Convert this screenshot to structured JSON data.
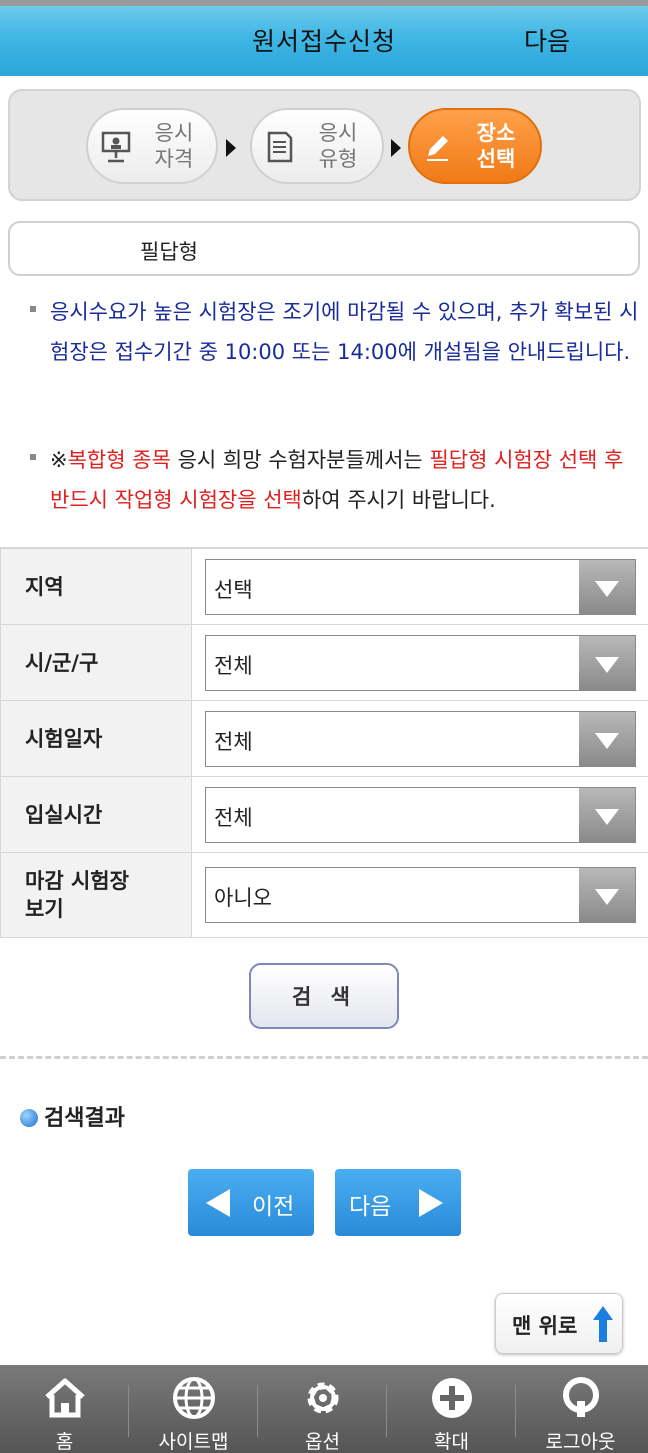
{
  "header": {
    "title": "원서접수신청",
    "next_label": "다음"
  },
  "steps": [
    {
      "label_line1": "응시",
      "label_line2": "자격",
      "icon": "presentation-icon",
      "active": false
    },
    {
      "label_line1": "응시",
      "label_line2": "유형",
      "icon": "document-icon",
      "active": false
    },
    {
      "label_line1": "장소",
      "label_line2": "선택",
      "icon": "pencil-icon",
      "active": true
    }
  ],
  "exam_type": "필답형",
  "notices": {
    "first": "응시수요가 높은 시험장은 조기에 마감될 수 있으며, 추가 확보된 시험장은 접수기간 중 10:00 또는 14:00에 개설됨을 안내드립니다.",
    "second_prefix": "※",
    "second_red1": "복합형 종목",
    "second_mid": " 응시 희망 수험자분들께서는 ",
    "second_red2": "필답형 시험장 선택 후 반드시 작업형 시험장을 선택",
    "second_suffix": "하여 주시기 바랍니다."
  },
  "form": {
    "region": {
      "label": "지역",
      "value": "선택"
    },
    "district": {
      "label": "시/군/구",
      "value": "전체"
    },
    "exam_date": {
      "label": "시험일자",
      "value": "전체"
    },
    "entry_time": {
      "label": "입실시간",
      "value": "전체"
    },
    "closed_sites": {
      "label_line1": "마감 시험장",
      "label_line2": "보기",
      "value": "아니오"
    }
  },
  "search_button": "검 색",
  "results": {
    "title": "검색결과"
  },
  "pager": {
    "prev_label": "이전",
    "next_label": "다음"
  },
  "top_button": "맨 위로",
  "tabbar": [
    {
      "label": "홈",
      "icon": "home-icon"
    },
    {
      "label": "사이트맵",
      "icon": "globe-icon"
    },
    {
      "label": "옵션",
      "icon": "gear-icon"
    },
    {
      "label": "확대",
      "icon": "plus-icon"
    },
    {
      "label": "로그아웃",
      "icon": "logout-icon"
    }
  ],
  "colors": {
    "header": "#3fb6e4",
    "active_step": "#f07a16",
    "notice_blue": "#1a2b9c",
    "notice_red": "#e0201c",
    "pager_blue": "#2a8ad8"
  }
}
